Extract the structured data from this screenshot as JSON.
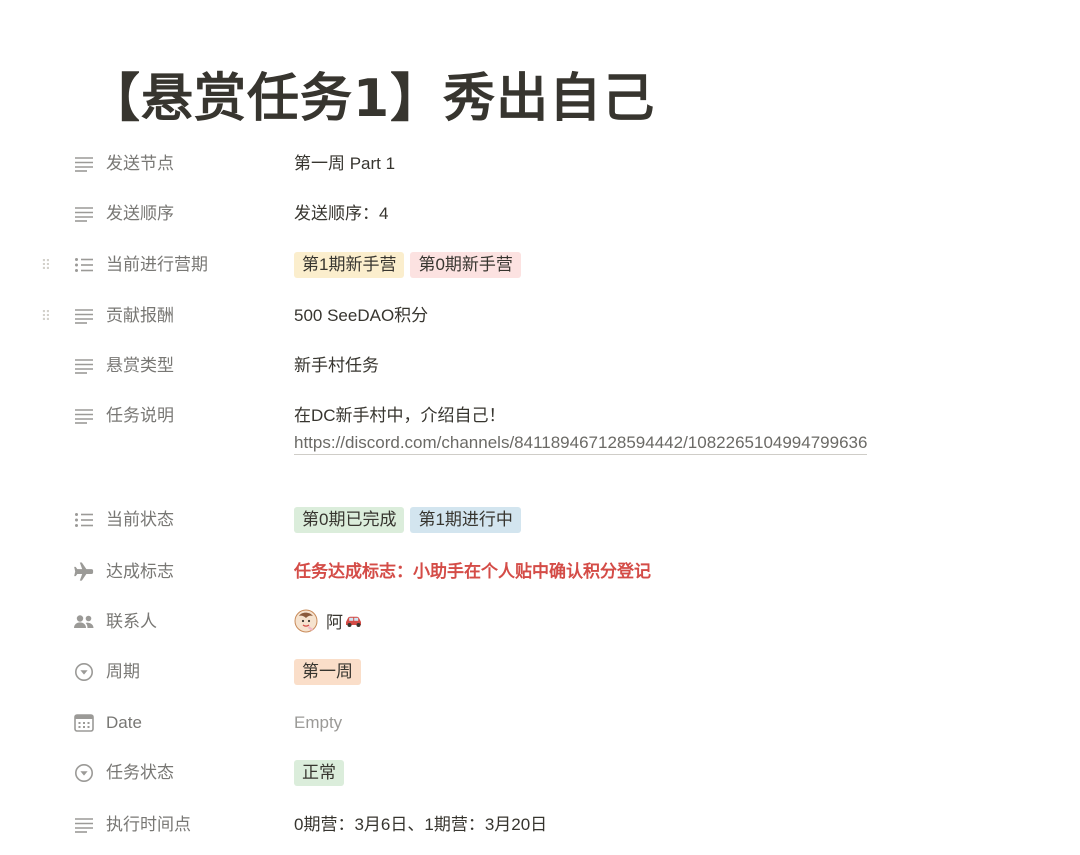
{
  "page": {
    "title": "【悬赏任务1】秀出自己"
  },
  "properties": [
    {
      "key": "send_node",
      "icon": "text-lines-icon",
      "label": "发送节点",
      "value": "第一周 Part 1"
    },
    {
      "key": "send_order",
      "icon": "text-lines-icon",
      "label": "发送顺序",
      "value": "发送顺序：4"
    },
    {
      "key": "current_camp",
      "icon": "multi-select-icon",
      "label": "当前进行营期",
      "tags": [
        {
          "text": "第1期新手营",
          "color": "#fbeecd"
        },
        {
          "text": "第0期新手营",
          "color": "#fce2e1"
        }
      ]
    },
    {
      "key": "reward",
      "icon": "text-lines-icon",
      "label": "贡献报酬",
      "value": "500 SeeDAO积分"
    },
    {
      "key": "bounty_type",
      "icon": "text-lines-icon",
      "label": "悬赏类型",
      "value": "新手村任务"
    },
    {
      "key": "task_desc",
      "icon": "text-lines-icon",
      "label": "任务说明",
      "value": "在DC新手村中，介绍自己！",
      "link": "https://discord.com/channels/841189467128594442/1082265104994799636"
    },
    {
      "key": "current_status",
      "icon": "multi-select-icon",
      "label": "当前状态",
      "tags": [
        {
          "text": "第0期已完成",
          "color": "#dbeddb"
        },
        {
          "text": "第1期进行中",
          "color": "#d3e5ef"
        }
      ]
    },
    {
      "key": "achievement",
      "icon": "airplane-icon",
      "label": "达成标志",
      "value": "任务达成标志：小助手在个人贴中确认积分登记",
      "value_color": "#d44c47"
    },
    {
      "key": "contact",
      "icon": "people-icon",
      "label": "联系人",
      "person": "阿"
    },
    {
      "key": "cycle",
      "icon": "select-icon",
      "label": "周期",
      "tags": [
        {
          "text": "第一周",
          "color": "#fadec9"
        }
      ]
    },
    {
      "key": "date",
      "icon": "calendar-icon",
      "label": "Date",
      "value": "Empty"
    },
    {
      "key": "task_status",
      "icon": "select-icon",
      "label": "任务状态",
      "tags": [
        {
          "text": "正常",
          "color": "#dbeddb"
        }
      ]
    },
    {
      "key": "exec_time",
      "icon": "text-lines-icon",
      "label": "执行时间点",
      "value": "0期营：3月6日、1期营：3月20日"
    }
  ],
  "colors": {
    "text": "#37352f",
    "label": "#787774",
    "accent_red": "#d44c47",
    "empty": "#9b9a97"
  }
}
